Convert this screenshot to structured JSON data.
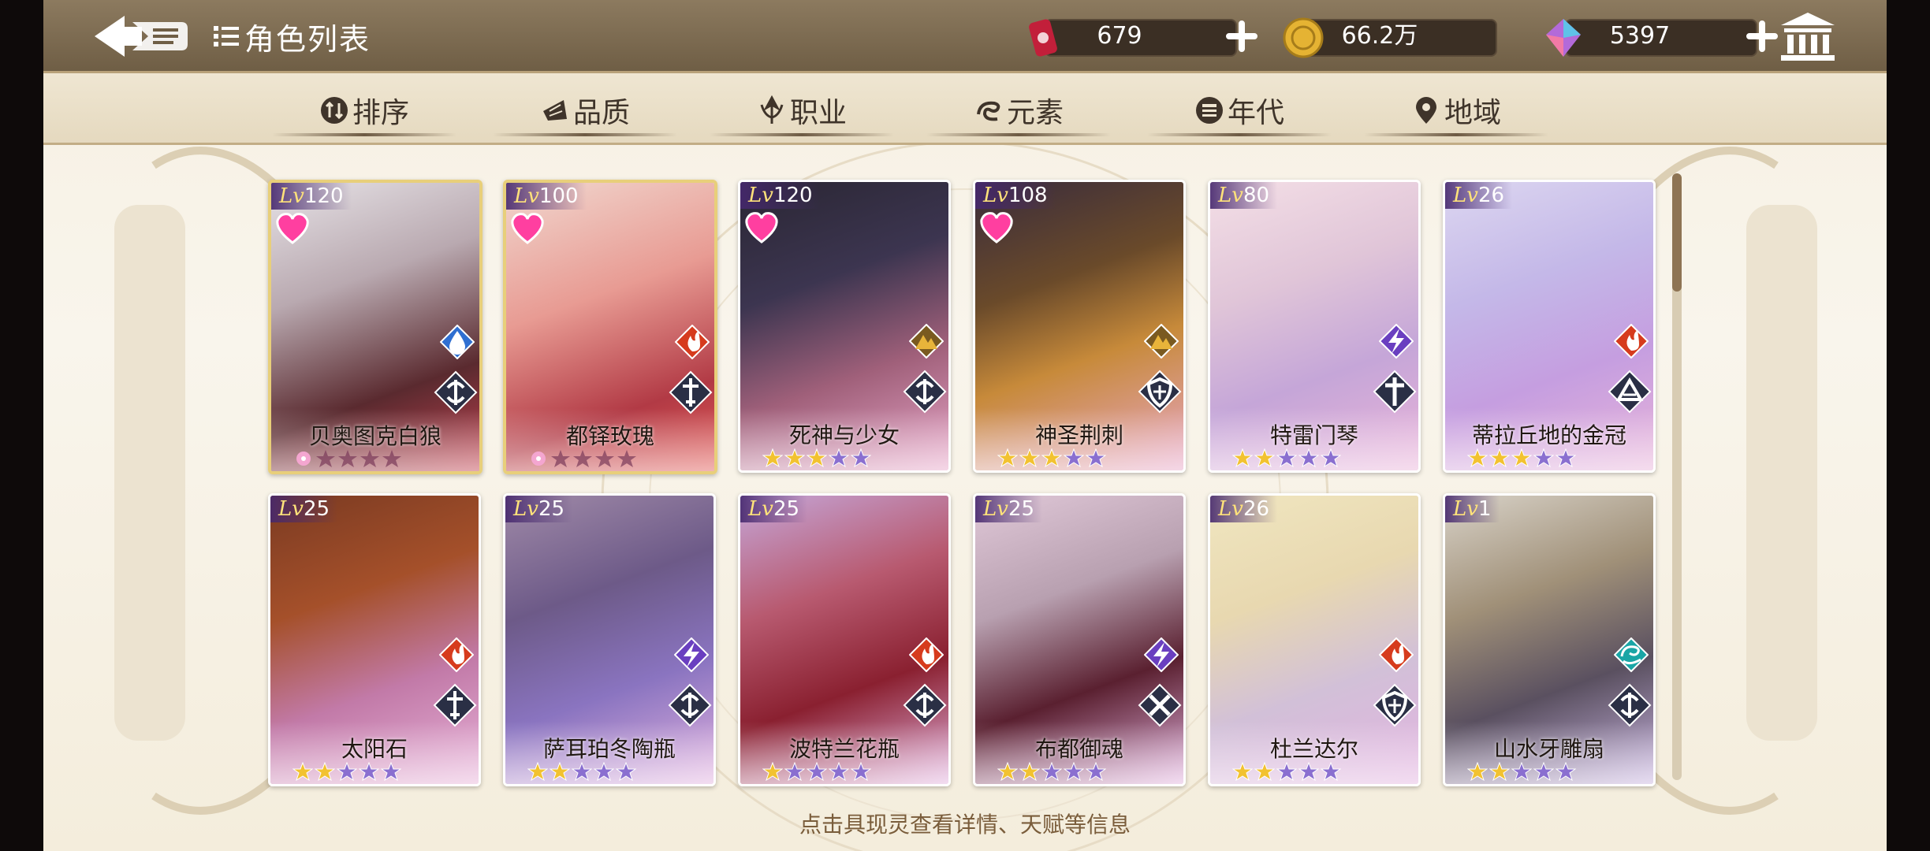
{
  "header": {
    "title": "角色列表",
    "currencies": [
      {
        "name": "stamina",
        "value": "679",
        "icon": "stamina-can-icon",
        "color": "#c21f3a"
      },
      {
        "name": "gold",
        "value": "66.2万",
        "icon": "gold-coin-icon",
        "color": "#e5b333"
      },
      {
        "name": "gem",
        "value": "5397",
        "icon": "rainbow-gem-icon",
        "color": "#b36ad9"
      }
    ]
  },
  "filters": [
    {
      "label": "排序",
      "icon": "sort-icon"
    },
    {
      "label": "品质",
      "icon": "quality-icon"
    },
    {
      "label": "职业",
      "icon": "class-icon"
    },
    {
      "label": "元素",
      "icon": "element-icon"
    },
    {
      "label": "年代",
      "icon": "era-icon"
    },
    {
      "label": "地域",
      "icon": "region-icon"
    }
  ],
  "level_prefix": "Lv",
  "characters": [
    {
      "level": "120",
      "name": "贝奥图克白狼",
      "stars": 0,
      "heart": true,
      "element": "water",
      "cls": "archer",
      "frame": "gold"
    },
    {
      "level": "100",
      "name": "都铎玫瑰",
      "stars": 0,
      "heart": true,
      "element": "fire",
      "cls": "sword",
      "frame": "gold"
    },
    {
      "level": "120",
      "name": "死神与少女",
      "stars": 3,
      "heart": true,
      "element": "earth",
      "cls": "archer",
      "frame": "purple"
    },
    {
      "level": "108",
      "name": "神圣荆刺",
      "stars": 3,
      "heart": true,
      "element": "earth",
      "cls": "shield",
      "frame": "purple"
    },
    {
      "level": "80",
      "name": "特雷门琴",
      "stars": 2,
      "heart": false,
      "element": "thunder",
      "cls": "cross",
      "frame": "purple"
    },
    {
      "level": "26",
      "name": "蒂拉丘地的金冠",
      "stars": 3,
      "heart": false,
      "element": "fire",
      "cls": "book",
      "frame": "purple"
    },
    {
      "level": "25",
      "name": "太阳石",
      "stars": 2,
      "heart": false,
      "element": "fire",
      "cls": "sword",
      "frame": "purple"
    },
    {
      "level": "25",
      "name": "萨耳珀冬陶瓶",
      "stars": 2,
      "heart": false,
      "element": "thunder",
      "cls": "archer",
      "frame": "purple"
    },
    {
      "level": "25",
      "name": "波特兰花瓶",
      "stars": 1,
      "heart": false,
      "element": "fire",
      "cls": "archer",
      "frame": "purple"
    },
    {
      "level": "25",
      "name": "布都御魂",
      "stars": 2,
      "heart": false,
      "element": "thunder",
      "cls": "crossed-swords",
      "frame": "purple"
    },
    {
      "level": "26",
      "name": "杜兰达尔",
      "stars": 2,
      "heart": false,
      "element": "fire",
      "cls": "shield",
      "frame": "purple"
    },
    {
      "level": "1",
      "name": "山水牙雕扇",
      "stars": 2,
      "heart": false,
      "element": "wind",
      "cls": "archer",
      "frame": "purple"
    }
  ],
  "hint": "点击具现灵查看详情、天赋等信息",
  "colors": {
    "accent": "#6f5e45",
    "star_gold": "#f2c230",
    "star_empty": "#8a6fd0"
  }
}
